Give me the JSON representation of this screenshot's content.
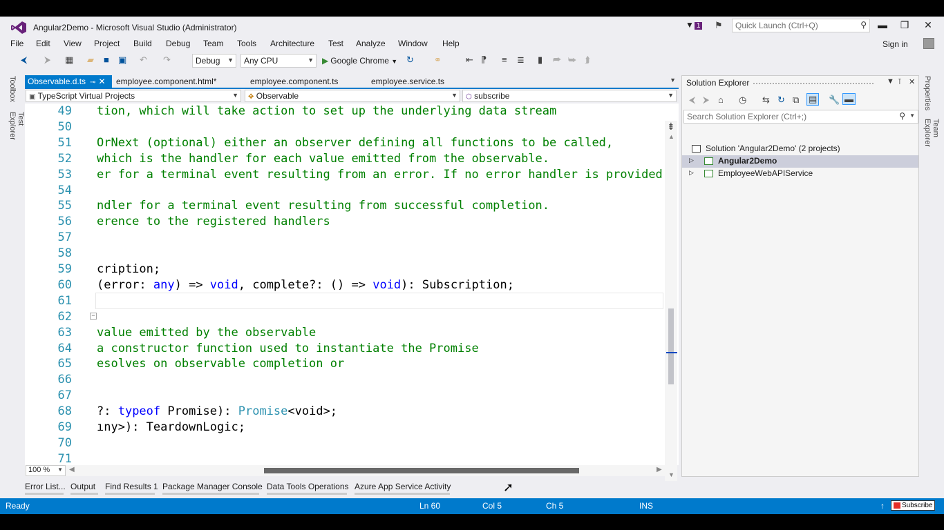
{
  "window": {
    "title": "Angular2Demo - Microsoft Visual Studio (Administrator)",
    "notification_count": "1",
    "quick_launch_placeholder": "Quick Launch (Ctrl+Q)",
    "controls": {
      "minimize": "▬",
      "restore": "❐",
      "close": "✕"
    },
    "sign_in": "Sign in"
  },
  "menu": [
    "File",
    "Edit",
    "View",
    "Project",
    "Build",
    "Debug",
    "Team",
    "Tools",
    "Architecture",
    "Test",
    "Analyze",
    "Window",
    "Help"
  ],
  "toolbar": {
    "configuration": "Debug",
    "platform": "Any CPU",
    "run_target": "Google Chrome"
  },
  "side_tabs_left": [
    "Toolbox",
    "Test Explorer"
  ],
  "side_tabs_right": [
    "Properties",
    "Team Explorer"
  ],
  "tabs": [
    {
      "label": "Observable.d.ts",
      "active": true
    },
    {
      "label": "employee.component.html*",
      "active": false
    },
    {
      "label": "employee.component.ts",
      "active": false
    },
    {
      "label": "employee.service.ts",
      "active": false
    }
  ],
  "navbar": {
    "project": "TypeScript Virtual Projects",
    "type": "Observable",
    "member": "subscribe"
  },
  "editor": {
    "lines": [
      {
        "no": "49",
        "segments": [
          {
            "t": "tion, which will take action to set up the underlying data stream",
            "c": "comment"
          }
        ]
      },
      {
        "no": "50",
        "segments": []
      },
      {
        "no": "51",
        "segments": [
          {
            "t": "OrNext (optional) either an observer defining all functions to be called,",
            "c": "comment"
          }
        ]
      },
      {
        "no": "52",
        "segments": [
          {
            "t": "which is the handler for each value emitted from the observable.",
            "c": "comment"
          }
        ]
      },
      {
        "no": "53",
        "segments": [
          {
            "t": "er for a terminal event resulting from an error. If no error handler is provided,",
            "c": "comment"
          }
        ]
      },
      {
        "no": "54",
        "segments": []
      },
      {
        "no": "55",
        "segments": [
          {
            "t": "ndler for a terminal event resulting from successful completion.",
            "c": "comment"
          }
        ]
      },
      {
        "no": "56",
        "segments": [
          {
            "t": "erence to the registered handlers",
            "c": "comment"
          }
        ]
      },
      {
        "no": "57",
        "segments": []
      },
      {
        "no": "58",
        "segments": []
      },
      {
        "no": "59",
        "segments": [
          {
            "t": "cription;",
            "c": "plain"
          }
        ]
      },
      {
        "no": "60",
        "segments": [
          {
            "t": "(error: ",
            "c": "plain"
          },
          {
            "t": "any",
            "c": "kw"
          },
          {
            "t": ") => ",
            "c": "plain"
          },
          {
            "t": "void",
            "c": "kw"
          },
          {
            "t": ", complete?: () => ",
            "c": "plain"
          },
          {
            "t": "void",
            "c": "kw"
          },
          {
            "t": "): Subscription;",
            "c": "plain"
          }
        ]
      },
      {
        "no": "61",
        "segments": []
      },
      {
        "no": "62",
        "segments": []
      },
      {
        "no": "63",
        "segments": [
          {
            "t": "value emitted by the observable",
            "c": "comment"
          }
        ]
      },
      {
        "no": "64",
        "segments": [
          {
            "t": "a constructor function used to instantiate the Promise",
            "c": "comment"
          }
        ]
      },
      {
        "no": "65",
        "segments": [
          {
            "t": "esolves on observable completion or",
            "c": "comment"
          }
        ]
      },
      {
        "no": "66",
        "segments": []
      },
      {
        "no": "67",
        "segments": []
      },
      {
        "no": "68",
        "segments": [
          {
            "t": "?: ",
            "c": "plain"
          },
          {
            "t": "typeof",
            "c": "kw"
          },
          {
            "t": " Promise): ",
            "c": "plain"
          },
          {
            "t": "Promise",
            "c": "type"
          },
          {
            "t": "<void>;",
            "c": "plain"
          }
        ]
      },
      {
        "no": "69",
        "segments": [
          {
            "t": "ıny>): TeardownLogic;",
            "c": "plain"
          }
        ]
      },
      {
        "no": "70",
        "segments": []
      },
      {
        "no": "71",
        "segments": []
      }
    ],
    "zoom": "100 %"
  },
  "solution_explorer": {
    "title": "Solution Explorer",
    "search_placeholder": "Search Solution Explorer (Ctrl+;)",
    "tree": [
      {
        "label": "Solution 'Angular2Demo' (2 projects)",
        "level": 0,
        "kind": "solution"
      },
      {
        "label": "Angular2Demo",
        "level": 1,
        "kind": "project",
        "selected": true,
        "bold": true
      },
      {
        "label": "EmployeeWebAPIService",
        "level": 1,
        "kind": "project",
        "selected": false,
        "bold": false
      }
    ]
  },
  "bottom_tabs": [
    "Error List...",
    "Output",
    "Find Results 1",
    "Package Manager Console",
    "Data Tools Operations",
    "Azure App Service Activity"
  ],
  "status": {
    "state": "Ready",
    "ln": "Ln 60",
    "col": "Col 5",
    "ch": "Ch 5",
    "mode": "INS",
    "badge": "Subscribe"
  },
  "colors": {
    "accent": "#007acc",
    "comment": "#008000",
    "keyword": "#0000ff",
    "line_number": "#2b91af"
  }
}
